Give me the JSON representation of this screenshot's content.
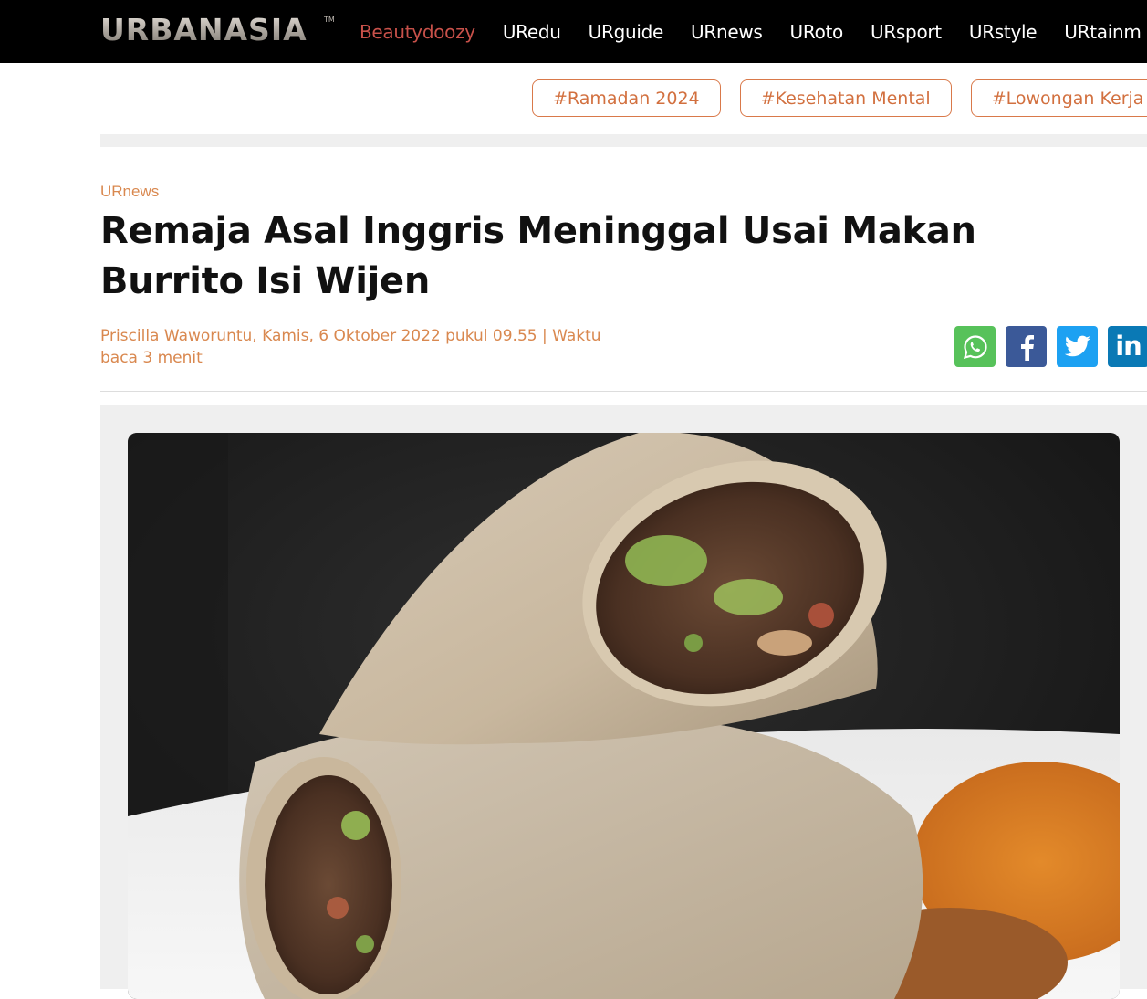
{
  "header": {
    "logo": "URBANASIA",
    "logo_tm": "TM",
    "nav": [
      "Beautydoozy",
      "URedu",
      "URguide",
      "URnews",
      "URoto",
      "URsport",
      "URstyle",
      "URtainm"
    ],
    "active_color": "#c8514a",
    "background": "#000000"
  },
  "tags": [
    "#Ramadan 2024",
    "#Kesehatan Mental",
    "#Lowongan Kerja"
  ],
  "article": {
    "category": "URnews",
    "title": "Remaja Asal Inggris Meninggal Usai Makan Burrito Isi Wijen",
    "byline": "Priscilla Waworuntu, Kamis, 6 Oktober 2022 pukul 09.55 | Waktu baca 3 menit",
    "accent_color": "#d9884f"
  },
  "share": [
    {
      "name": "whatsapp-icon",
      "color": "#57c25a"
    },
    {
      "name": "facebook-icon",
      "color": "#3b5998"
    },
    {
      "name": "twitter-icon",
      "color": "#1da1f2"
    },
    {
      "name": "linkedin-icon",
      "color": "#0a79b5",
      "label": "in"
    }
  ],
  "hero": {
    "icon": "burrito-photo"
  }
}
